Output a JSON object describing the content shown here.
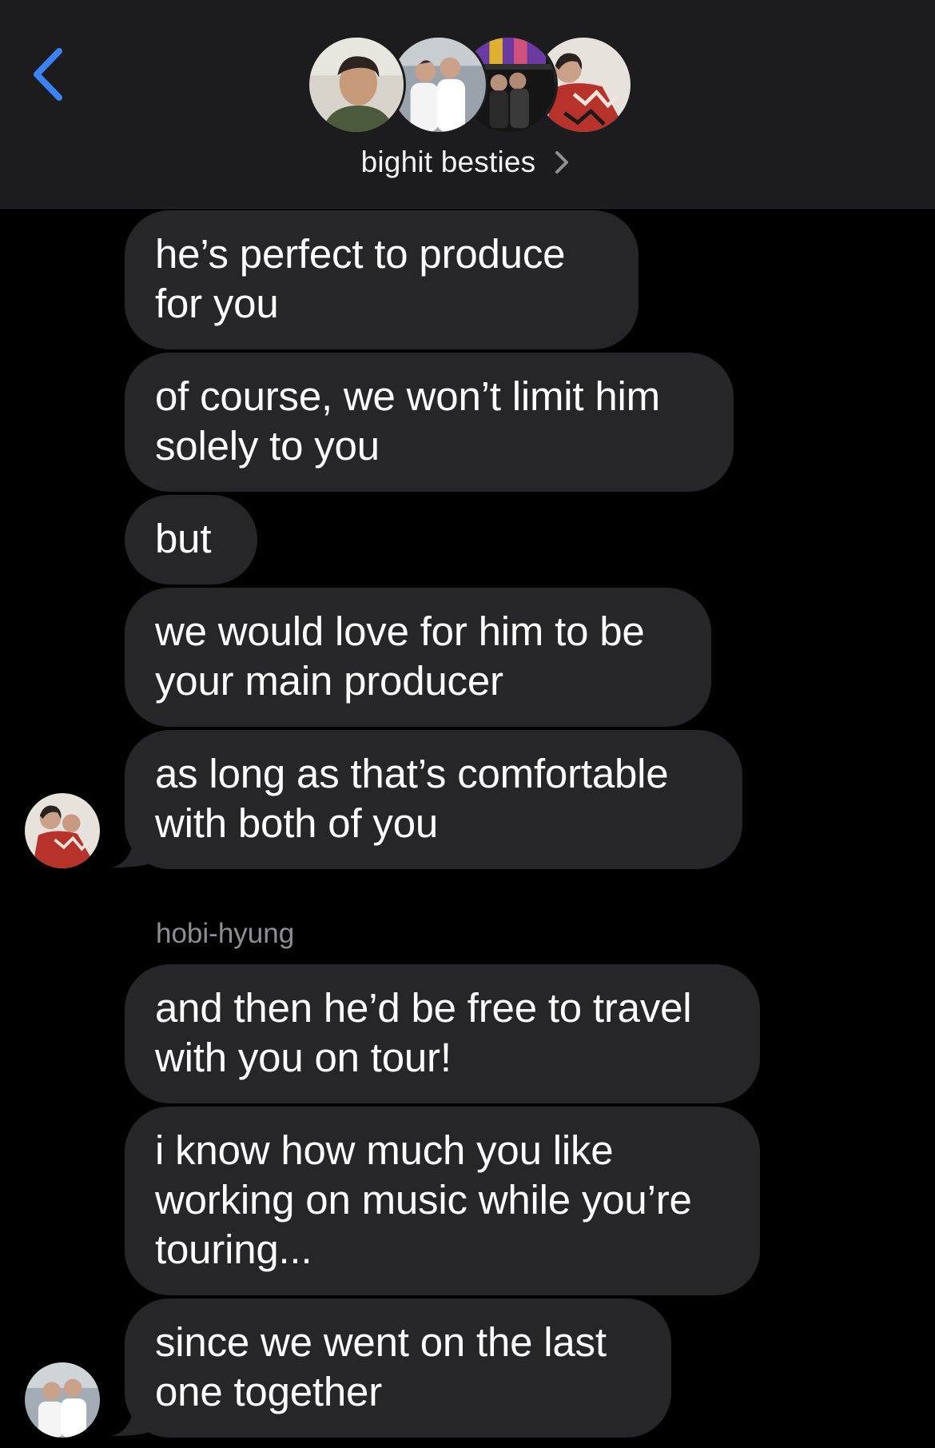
{
  "header": {
    "group_name": "bighit besties",
    "accent_color": "#3b82f6"
  },
  "messages": [
    {
      "text": "he’s perfect to produce\nfor you"
    },
    {
      "text": "of course, we won’t limit him\nsolely to you"
    },
    {
      "text": "but"
    },
    {
      "text": "we would love for him to be\nyour main producer"
    },
    {
      "text": "as long as that’s comfortable\nwith both of you"
    },
    {
      "text": "and then he’d be free to travel\nwith you on tour!"
    },
    {
      "text": "i know how much you like\nworking on music while you’re\ntouring..."
    },
    {
      "text": "since we went on the last\none together"
    }
  ],
  "sender_label": "hobi-hyung",
  "colors": {
    "bubble_bg": "#262628",
    "header_bg": "#1c1c1e",
    "background": "#000000",
    "secondary_text": "#8e8e93"
  }
}
